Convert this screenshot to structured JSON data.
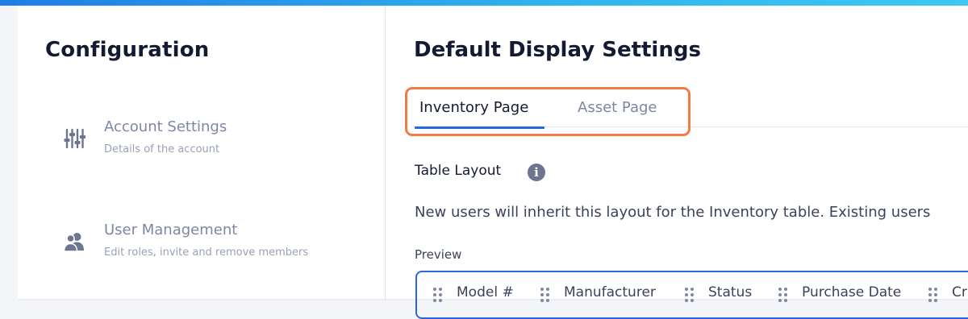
{
  "sidebar": {
    "title": "Configuration",
    "items": [
      {
        "label": "Account Settings",
        "description": "Details of the account",
        "icon": "sliders-icon"
      },
      {
        "label": "User Management",
        "description": "Edit roles, invite and remove members",
        "icon": "users-icon"
      }
    ]
  },
  "main": {
    "title": "Default Display Settings",
    "tabs": [
      {
        "label": "Inventory Page",
        "active": true
      },
      {
        "label": "Asset Page",
        "active": false
      }
    ],
    "section_title": "Table Layout",
    "info_glyph": "i",
    "description": "New users will inherit this layout for the Inventory table. Existing users",
    "preview_label": "Preview",
    "columns": [
      "Model #",
      "Manufacturer",
      "Status",
      "Purchase Date",
      "Cr"
    ]
  },
  "colors": {
    "accent": "#2a66e0",
    "highlight": "#f07b46",
    "heading": "#151a33",
    "muted": "#7e86a4"
  }
}
